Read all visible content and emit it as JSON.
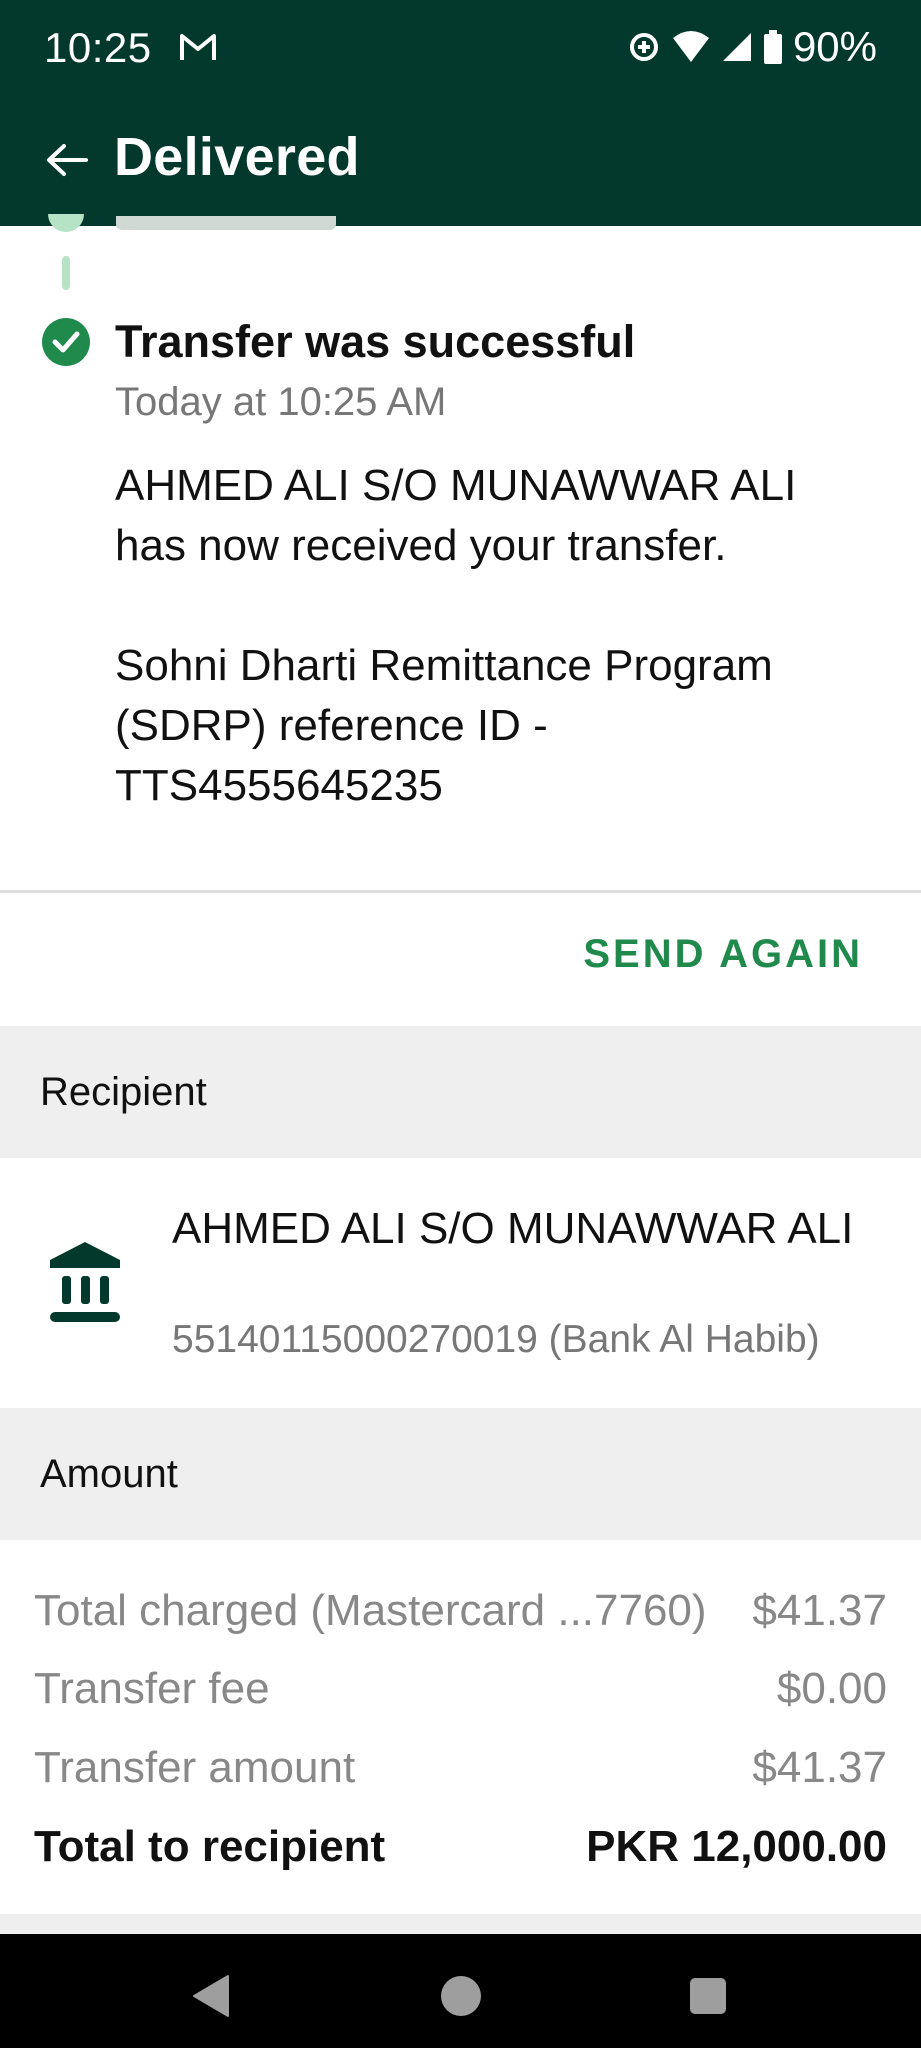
{
  "status_bar": {
    "time": "10:25",
    "battery_percent": "90%",
    "icons": [
      "gmail-icon",
      "data-saver-icon",
      "wifi-icon",
      "signal-icon",
      "battery-icon"
    ]
  },
  "app_bar": {
    "title": "Delivered"
  },
  "event": {
    "title": "Transfer was successful",
    "time": "Today at 10:25 AM",
    "body": "AHMED ALI S/O MUNAWWAR ALI has now received your transfer.\n\nSohni Dharti Remittance Program (SDRP) reference ID - TTS4555645235"
  },
  "send_again_label": "SEND AGAIN",
  "recipient_section": {
    "heading": "Recipient",
    "name": "AHMED ALI S/O MUNAWWAR ALI",
    "account": "55140115000270019 (Bank Al Habib)"
  },
  "amount_section": {
    "heading": "Amount",
    "rows": [
      {
        "label": "Total charged (Mastercard ...7760)",
        "value": "$41.37"
      },
      {
        "label": "Transfer fee",
        "value": "$0.00"
      },
      {
        "label": "Transfer amount",
        "value": "$41.37"
      },
      {
        "label": "Total to recipient",
        "value": "PKR 12,000.00"
      }
    ]
  },
  "colors": {
    "header_bg": "#02392c",
    "accent_green": "#1f8a4c",
    "section_bg": "#efefef",
    "muted_text": "#777777"
  }
}
